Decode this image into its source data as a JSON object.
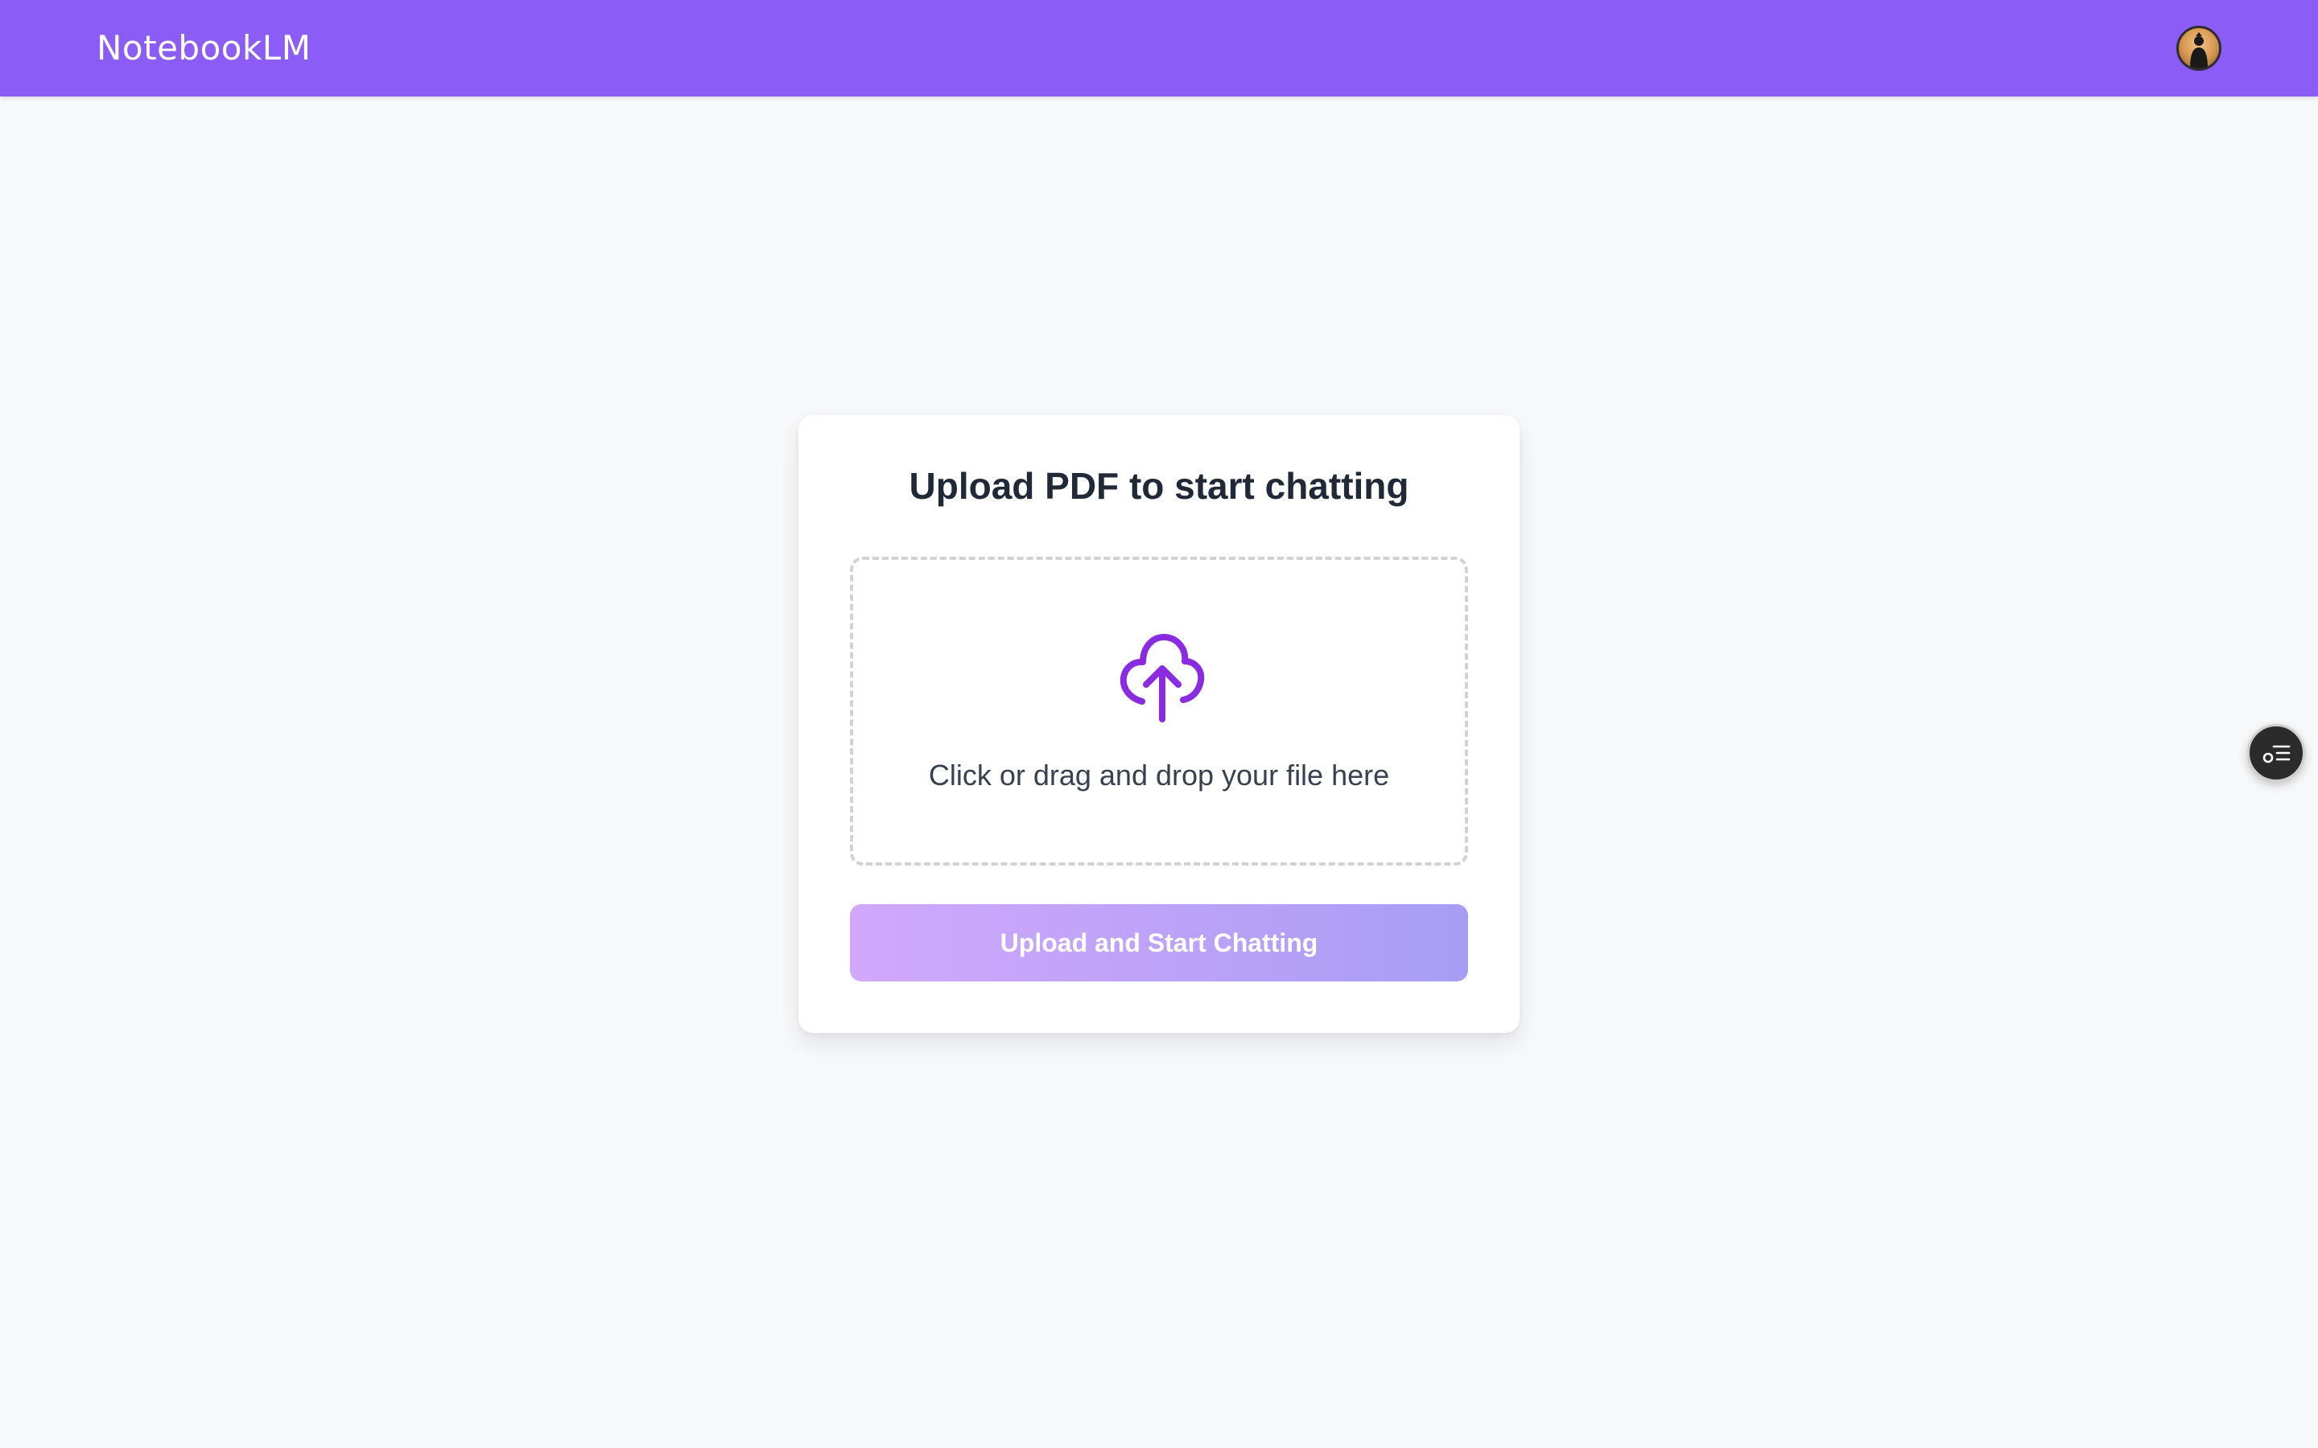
{
  "header": {
    "app_title": "NotebookLM",
    "background_color": "#8b5cf6",
    "avatar_icon": "user-avatar"
  },
  "upload_card": {
    "title": "Upload PDF to start chatting",
    "dropzone": {
      "icon": "cloud-upload-icon",
      "icon_color": "#8a2be2",
      "prompt": "Click or drag and drop your file here"
    },
    "submit_button": {
      "label": "Upload and Start Chatting",
      "gradient_colors": [
        "#d2a8fb",
        "#a79df5"
      ]
    }
  },
  "floating_widget": {
    "icon": "list-toggle-icon"
  }
}
